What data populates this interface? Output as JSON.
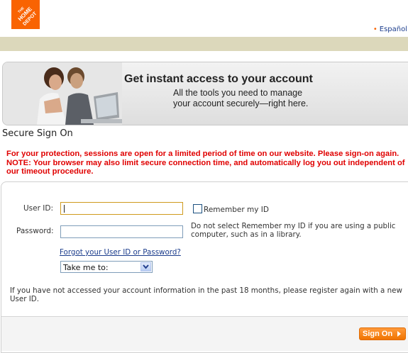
{
  "header": {
    "logo_text": "THE HOME DEPOT",
    "language_link": "Español"
  },
  "banner": {
    "title": "Get instant access to your account",
    "subtitle_line1": "All the tools you need to manage",
    "subtitle_line2": "your account securely—right here."
  },
  "signon": {
    "section_title": "Secure Sign On",
    "warning_text": "For your protection, sessions are open for a limited period of time on our website. Please sign-on again. NOTE: Your browser may also limit secure connection time, and automatically log you out independent of our timeout procedure.",
    "user_id_label": "User ID:",
    "user_id_value": "",
    "password_label": "Password:",
    "password_value": "",
    "remember_label": "Remember my ID",
    "remember_checked": false,
    "remember_note": "Do not select Remember my ID if you are using a public computer, such as in a library.",
    "forgot_link": "Forgot your User ID or Password?",
    "take_me_to": "Take me to:",
    "register_note": "If you have not accessed your account information in the past 18 months, please register again with a new User ID.",
    "signon_button": "Sign On"
  },
  "colors": {
    "brand_orange": "#f96302",
    "warning_red": "#e00000",
    "link_blue": "#1b3c8c",
    "tan_bar": "#dcd8bb"
  }
}
